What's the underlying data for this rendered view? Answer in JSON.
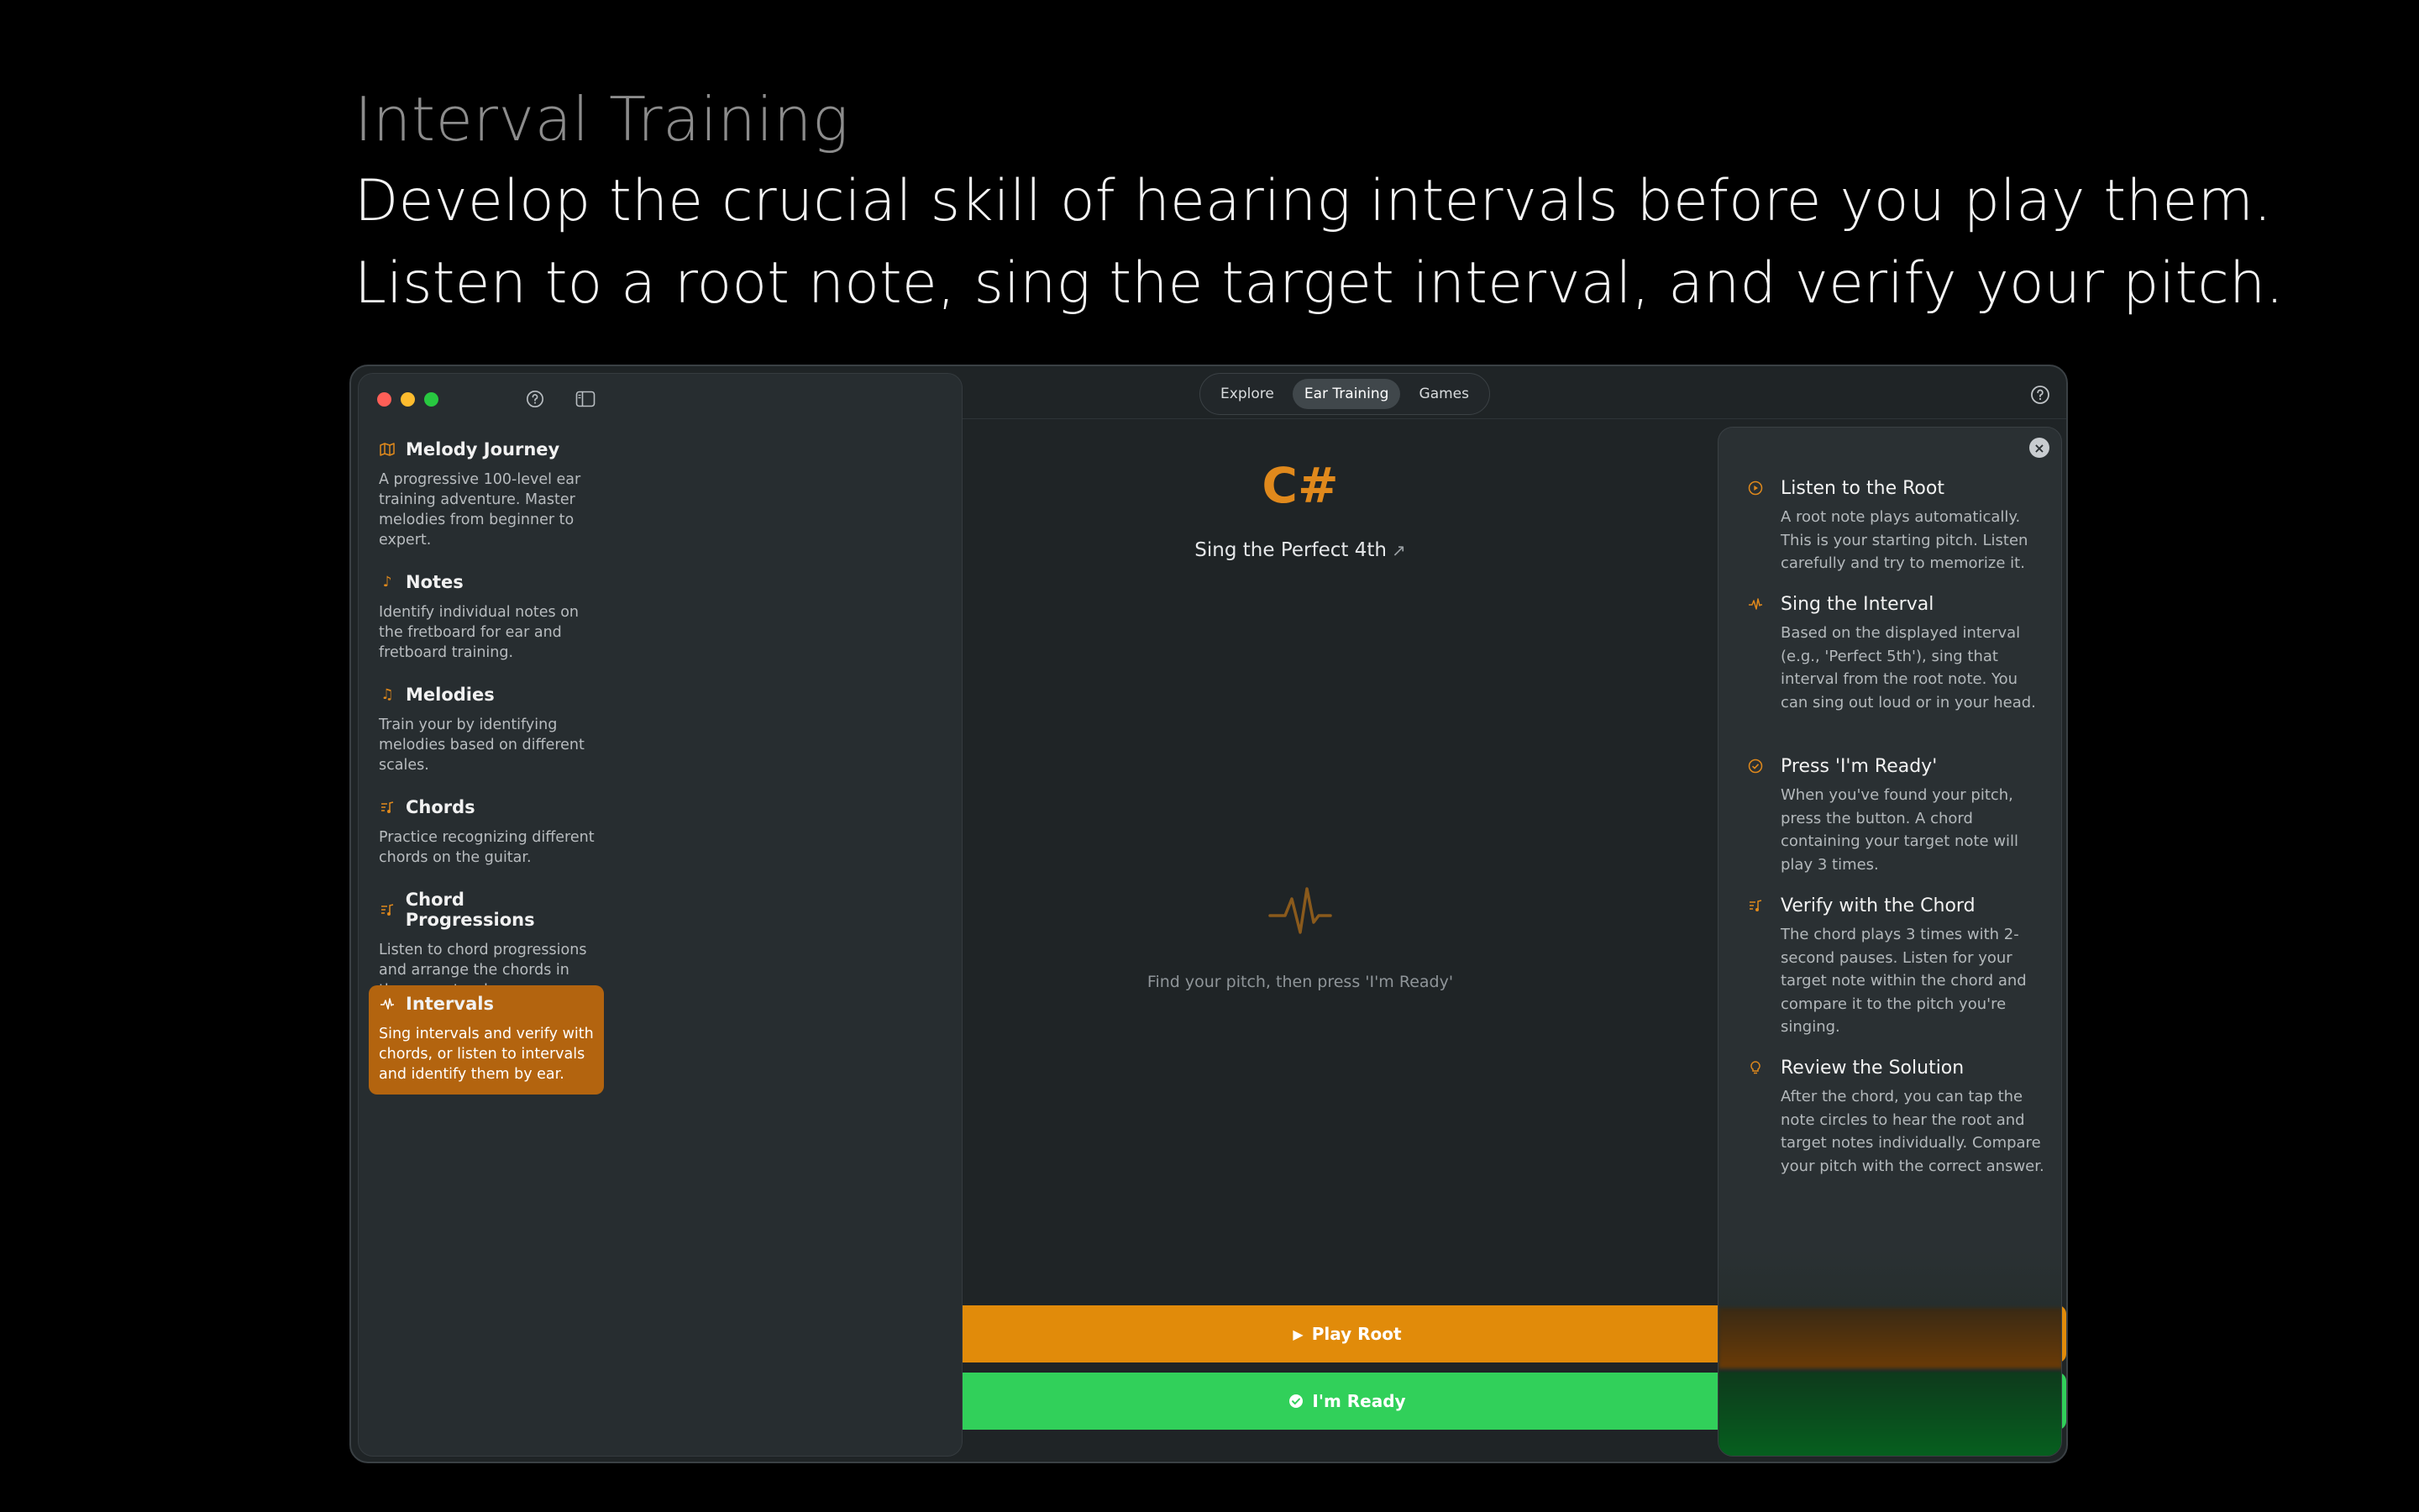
{
  "hero": {
    "kicker": "Interval Training",
    "line1": "Develop the crucial skill of hearing intervals before you play them.",
    "line2": "Listen to a root note, sing the target interval, and verify your pitch."
  },
  "sidebar": {
    "items": [
      {
        "label": "Melody Journey",
        "icon": "map-icon",
        "desc": "A progressive 100-level ear training adventure. Master melodies from beginner to expert.",
        "active": false
      },
      {
        "label": "Notes",
        "icon": "music-note-icon",
        "desc": "Identify individual notes on the fretboard for ear and fretboard training.",
        "active": false
      },
      {
        "label": "Melodies",
        "icon": "music-notes-icon",
        "desc": "Train your by identifying melodies based on different scales.",
        "active": false
      },
      {
        "label": "Chords",
        "icon": "chord-icon",
        "desc": "Practice recognizing different chords on the guitar.",
        "active": false
      },
      {
        "label": "Chord Progressions",
        "icon": "chord-progression-icon",
        "desc": "Listen to chord progressions and arrange the chords in the correct order.",
        "active": false
      },
      {
        "label": "Intervals",
        "icon": "waveform-icon",
        "desc": "Sing intervals and verify with chords, or listen to intervals and identify them by ear.",
        "active": true
      }
    ]
  },
  "nav": {
    "tabs": [
      {
        "label": "Explore",
        "active": false
      },
      {
        "label": "Ear Training",
        "active": true
      },
      {
        "label": "Games",
        "active": false
      }
    ]
  },
  "exercise": {
    "root_note": "C#",
    "instruction": "Sing the Perfect 4th",
    "instruction_arrow": "↗",
    "hint": "Find your pitch, then press 'I'm Ready'",
    "play_root_label": "Play Root",
    "ready_label": "I'm Ready"
  },
  "help_panel": {
    "steps": [
      {
        "title": "Listen to the Root",
        "icon": "play-circle-icon",
        "desc": "A root note plays automatically. This is your starting pitch. Listen carefully and try to memorize it."
      },
      {
        "title": "Sing the Interval",
        "icon": "waveform-icon",
        "desc": "Based on the displayed interval (e.g., 'Perfect 5th'), sing that interval from the root note. You can sing out loud or in your head."
      },
      {
        "title": "Press 'I'm Ready'",
        "icon": "check-circle-icon",
        "desc": "When you've found your pitch, press the button. A chord containing your target note will play 3 times."
      },
      {
        "title": "Verify with the Chord",
        "icon": "chord-icon",
        "desc": "The chord plays 3 times with 2-second pauses. Listen for your target note within the chord and compare it to the pitch you're singing."
      },
      {
        "title": "Review the Solution",
        "icon": "lightbulb-icon",
        "desc": "After the chord, you can tap the note circles to hear the root and target notes individually. Compare your pitch with the correct answer."
      }
    ]
  },
  "colors": {
    "accent_orange": "#e18b0a",
    "accent_green": "#31d05a",
    "active_sidebar": "#b3640f"
  }
}
